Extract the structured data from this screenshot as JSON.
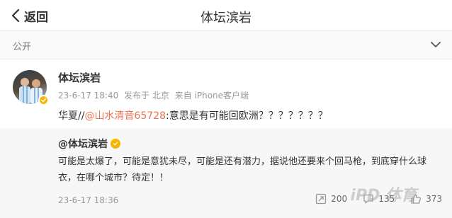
{
  "header": {
    "back_label": "返回",
    "title": "体坛滨岩"
  },
  "visibility": {
    "label": "公开"
  },
  "post": {
    "author": "体坛滨岩",
    "meta": {
      "time": "23-6-17 18:40",
      "location": "发布于 北京",
      "source": "来自 iPhone客户端"
    },
    "text_prefix": "华夏//",
    "mention": "@山水清音65728",
    "text_suffix": ":意思是有可能回欧洲？？？？？？？"
  },
  "repost": {
    "author": "@体坛滨岩",
    "body": "可能是太爆了，可能是意犹未尽，可能是还有潜力，据说他还要来个回马枪，到底穿什么球衣，在哪个城市？待定！！",
    "time": "23-6-17 18:36",
    "stats": {
      "reposts": "200",
      "comments": "135",
      "likes": "373"
    }
  },
  "watermark": "iPD 体育",
  "icons": {
    "back": "chevron-left-icon",
    "visibility_toggle": "chevron-down-icon",
    "verified": "verified-badge-icon",
    "repost": "repost-icon",
    "comment": "comment-icon",
    "like": "like-icon"
  }
}
